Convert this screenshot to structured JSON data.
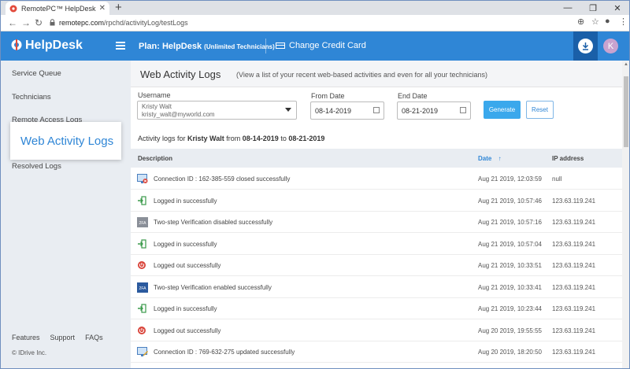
{
  "browser": {
    "tab_title": "RemotePC™ HelpDesk - Web Ac",
    "url_host": "remotepc.com",
    "url_path": "/rpchd/activityLog/testLogs"
  },
  "header": {
    "logo": "HelpDesk",
    "plan_label": "Plan: HelpDesk",
    "plan_sub": "(Unlimited Technicians)",
    "change_card": "Change Credit Card",
    "avatar_initial": "K"
  },
  "sidebar": {
    "items": [
      "Service Queue",
      "Technicians",
      "Remote Access Logs",
      "Web Activity Logs",
      "Resolved Logs"
    ],
    "highlight": "Web Activity Logs",
    "footer_links": [
      "Features",
      "Support",
      "FAQs"
    ],
    "copyright": "© IDrive Inc."
  },
  "main": {
    "title": "Web Activity Logs",
    "description": "(View a list of your recent web-based activities and even for all your technicians)",
    "username_label": "Username",
    "username_name": "Kristy Walt",
    "username_email": "kristy_walt@myworld.com",
    "from_label": "From Date",
    "from_value": "08-14-2019",
    "end_label": "End Date",
    "end_value": "08-21-2019",
    "generate": "Generate",
    "reset": "Reset",
    "summary_prefix": "Activity logs for",
    "summary_user": "Kristy Walt",
    "summary_from_word": "from",
    "summary_from": "08-14-2019",
    "summary_to_word": "to",
    "summary_to": "08-21-2019",
    "columns": {
      "description": "Description",
      "date": "Date",
      "ip": "IP address"
    },
    "rows": [
      {
        "icon": "monitor-closed-icon",
        "description": "Connection ID : 162-385-559 closed successfully",
        "date": "Aug 21 2019, 12:03:59",
        "ip": "null"
      },
      {
        "icon": "login-icon",
        "description": "Logged in successfully",
        "date": "Aug 21 2019, 10:57:46",
        "ip": "123.63.119.241"
      },
      {
        "icon": "2fa-disabled-icon",
        "description": "Two-step Verification disabled successfully",
        "date": "Aug 21 2019, 10:57:16",
        "ip": "123.63.119.241"
      },
      {
        "icon": "login-icon",
        "description": "Logged in successfully",
        "date": "Aug 21 2019, 10:57:04",
        "ip": "123.63.119.241"
      },
      {
        "icon": "logout-icon",
        "description": "Logged out successfully",
        "date": "Aug 21 2019, 10:33:51",
        "ip": "123.63.119.241"
      },
      {
        "icon": "2fa-enabled-icon",
        "description": "Two-step Verification enabled successfully",
        "date": "Aug 21 2019, 10:33:41",
        "ip": "123.63.119.241"
      },
      {
        "icon": "login-icon",
        "description": "Logged in successfully",
        "date": "Aug 21 2019, 10:23:44",
        "ip": "123.63.119.241"
      },
      {
        "icon": "logout-icon",
        "description": "Logged out successfully",
        "date": "Aug 20 2019, 19:55:55",
        "ip": "123.63.119.241"
      },
      {
        "icon": "monitor-updated-icon",
        "description": "Connection ID : 769-632-275 updated successfully",
        "date": "Aug 20 2019, 18:20:50",
        "ip": "123.63.119.241"
      }
    ]
  }
}
